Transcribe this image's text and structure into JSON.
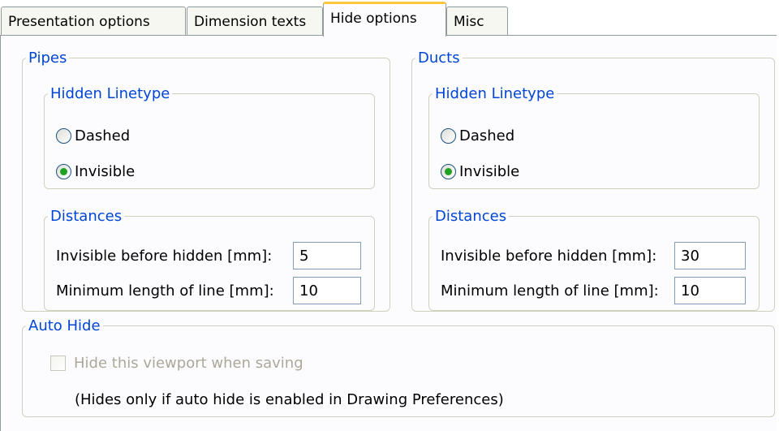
{
  "tabs": [
    {
      "label": "Presentation options",
      "active": false
    },
    {
      "label": "Dimension texts",
      "active": false
    },
    {
      "label": "Hide options",
      "active": true
    },
    {
      "label": "Misc",
      "active": false
    }
  ],
  "pipes": {
    "title": "Pipes",
    "linetype": {
      "title": "Hidden Linetype",
      "options": [
        "Dashed",
        "Invisible"
      ],
      "selected": "Invisible"
    },
    "distances": {
      "title": "Distances",
      "invisible_before_hidden_label": "Invisible before hidden [mm]:",
      "invisible_before_hidden_value": "5",
      "min_length_label": "Minimum length of line [mm]:",
      "min_length_value": "10"
    }
  },
  "ducts": {
    "title": "Ducts",
    "linetype": {
      "title": "Hidden Linetype",
      "options": [
        "Dashed",
        "Invisible"
      ],
      "selected": "Invisible"
    },
    "distances": {
      "title": "Distances",
      "invisible_before_hidden_label": "Invisible before hidden [mm]:",
      "invisible_before_hidden_value": "30",
      "min_length_label": "Minimum length of line [mm]:",
      "min_length_value": "10"
    }
  },
  "auto_hide": {
    "title": "Auto Hide",
    "checkbox_label": "Hide this viewport when saving",
    "checked": false,
    "enabled": false,
    "note": "(Hides only if auto hide is enabled in Drawing Preferences)"
  },
  "colors": {
    "legend_text": "#0046d5",
    "radio_selected": "#21a121",
    "active_tab_highlight": "#ffc83c",
    "disabled_text": "#aca899"
  }
}
